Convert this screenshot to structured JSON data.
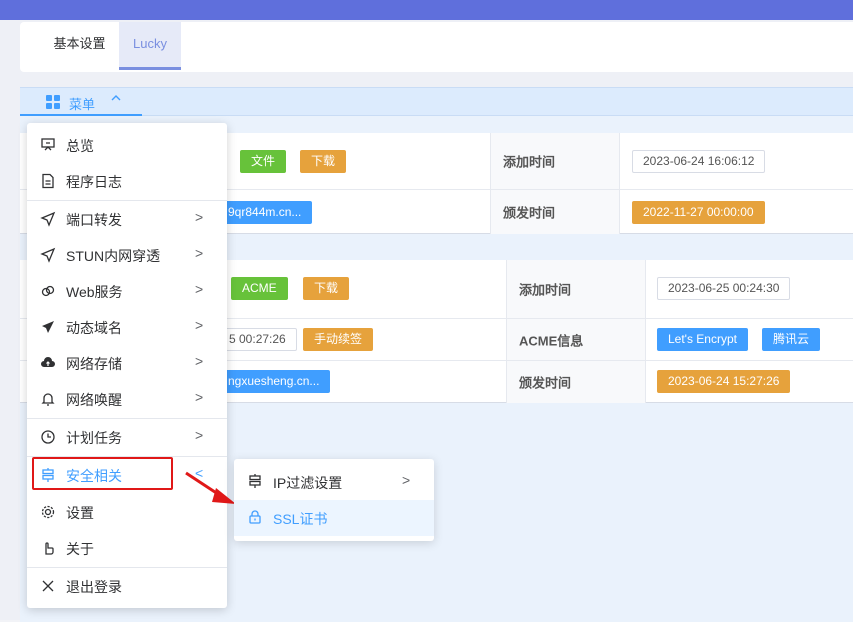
{
  "tabs": {
    "basic": "基本设置",
    "lucky": "Lucky"
  },
  "menu_trigger": {
    "label": "菜单",
    "chevron": "^",
    "icon": "grid-icon"
  },
  "panel1": {
    "file_btn": "文件",
    "download_btn": "下载",
    "domain_partial": "9qr844m.cn...",
    "add_time_label": "添加时间",
    "add_time_value": "2023-06-24 16:06:12",
    "issue_time_label": "颁发时间",
    "issue_time_value": "2022-11-27 00:00:00"
  },
  "panel2": {
    "acme_btn": "ACME",
    "download_btn": "下载",
    "time_partial": "5 00:27:26",
    "renew_btn": "手动续签",
    "domain_partial": "ngxuesheng.cn...",
    "add_time_label": "添加时间",
    "add_time_value": "2023-06-25 00:24:30",
    "acme_info_label": "ACME信息",
    "acme_provider": "Let's Encrypt",
    "acme_dns": "腾讯云",
    "issue_time_label": "颁发时间",
    "issue_time_value": "2023-06-24 15:27:26"
  },
  "dropdown": {
    "items": [
      {
        "label": "总览",
        "icon": "presentation-icon",
        "arrow": ""
      },
      {
        "label": "程序日志",
        "icon": "document-icon",
        "arrow": ""
      },
      {
        "label": "端口转发",
        "icon": "send-icon",
        "arrow": ">"
      },
      {
        "label": "STUN内网穿透",
        "icon": "send-icon",
        "arrow": ">"
      },
      {
        "label": "Web服务",
        "icon": "link-icon",
        "arrow": ">"
      },
      {
        "label": "动态域名",
        "icon": "paper-plane-icon",
        "arrow": ">"
      },
      {
        "label": "网络存储",
        "icon": "cloud-upload-icon",
        "arrow": ">"
      },
      {
        "label": "网络唤醒",
        "icon": "bell-icon",
        "arrow": ">"
      },
      {
        "label": "计划任务",
        "icon": "clock-icon",
        "arrow": ">"
      },
      {
        "label": "安全相关",
        "icon": "signpost-icon",
        "arrow": "<"
      },
      {
        "label": "设置",
        "icon": "gear-icon",
        "arrow": ""
      },
      {
        "label": "关于",
        "icon": "pointer-icon",
        "arrow": ""
      },
      {
        "label": "退出登录",
        "icon": "close-icon",
        "arrow": ""
      }
    ]
  },
  "submenu": {
    "items": [
      {
        "label": "IP过滤设置",
        "icon": "signpost-icon",
        "arrow": ">"
      },
      {
        "label": "SSL证书",
        "icon": "lock-icon",
        "arrow": ""
      }
    ]
  },
  "colors": {
    "accent": "#409eff",
    "topbar": "#5f6fdc",
    "annotation": "#e01818"
  }
}
